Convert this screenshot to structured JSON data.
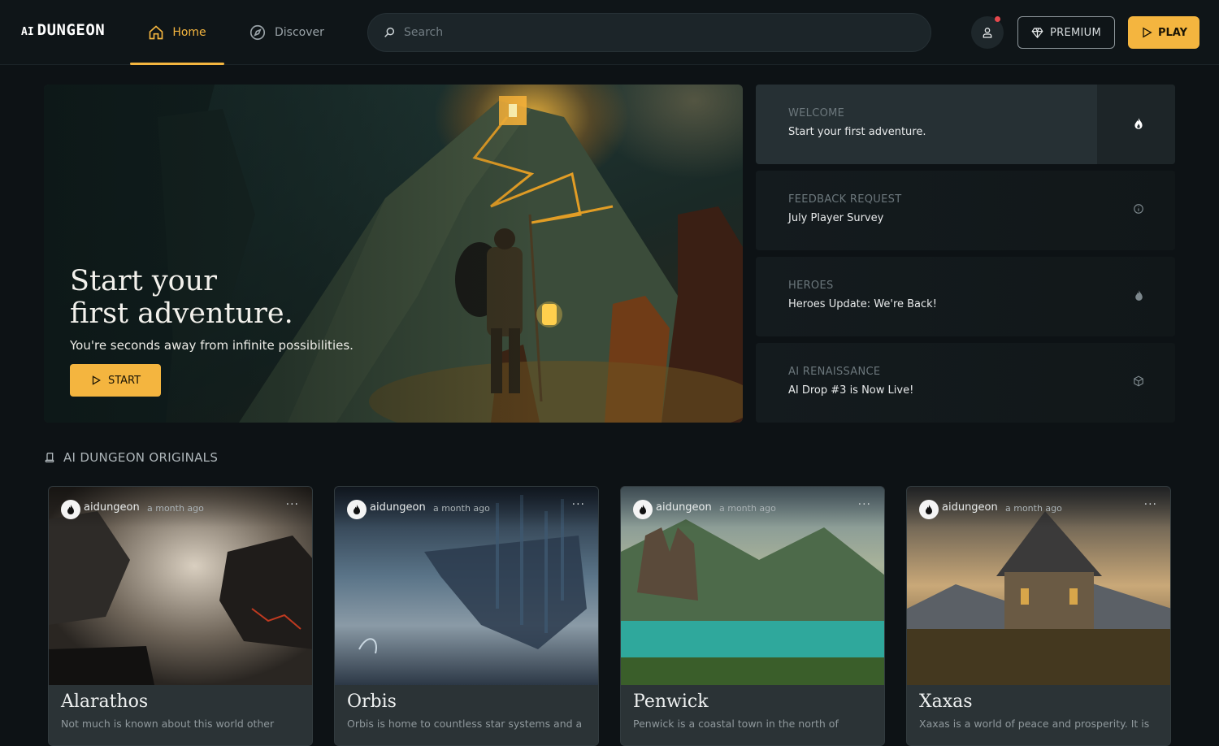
{
  "header": {
    "logo_prefix": "AI",
    "logo_text": "DUNGEON",
    "nav": [
      {
        "label": "Home",
        "icon": "home-icon",
        "active": true
      },
      {
        "label": "Discover",
        "icon": "compass-icon",
        "active": false
      }
    ],
    "search_placeholder": "Search",
    "premium_label": "PREMIUM",
    "play_label": "PLAY"
  },
  "hero": {
    "title": "Start your\nfirst adventure.",
    "subtitle": "You're seconds away from infinite possibilities.",
    "start_label": "START"
  },
  "news": [
    {
      "category": "WELCOME",
      "title": "Start your first adventure.",
      "icon": "flame-icon"
    },
    {
      "category": "FEEDBACK REQUEST",
      "title": "July Player Survey",
      "icon": "info-icon"
    },
    {
      "category": "HEROES",
      "title": "Heroes Update: We're Back!",
      "icon": "flame-icon"
    },
    {
      "category": "AI RENAISSANCE",
      "title": "AI Drop #3 is Now Live!",
      "icon": "cube-icon"
    }
  ],
  "originals": {
    "heading": "AI DUNGEON ORIGINALS",
    "cards": [
      {
        "author": "aidungeon",
        "time": "a month ago",
        "menu": "···",
        "title": "Alarathos",
        "description": "Not much is known about this world other"
      },
      {
        "author": "aidungeon",
        "time": "a month ago",
        "menu": "···",
        "title": "Orbis",
        "description": "Orbis is home to countless star systems and a"
      },
      {
        "author": "aidungeon",
        "time": "a month ago",
        "menu": "···",
        "title": "Penwick",
        "description": "Penwick is a coastal town in the north of"
      },
      {
        "author": "aidungeon",
        "time": "a month ago",
        "menu": "···",
        "title": "Xaxas",
        "description": "Xaxas is a world of peace and prosperity. It is"
      }
    ]
  },
  "colors": {
    "accent": "#f4b53f",
    "background": "#0d1215",
    "notification": "#e5484d"
  }
}
